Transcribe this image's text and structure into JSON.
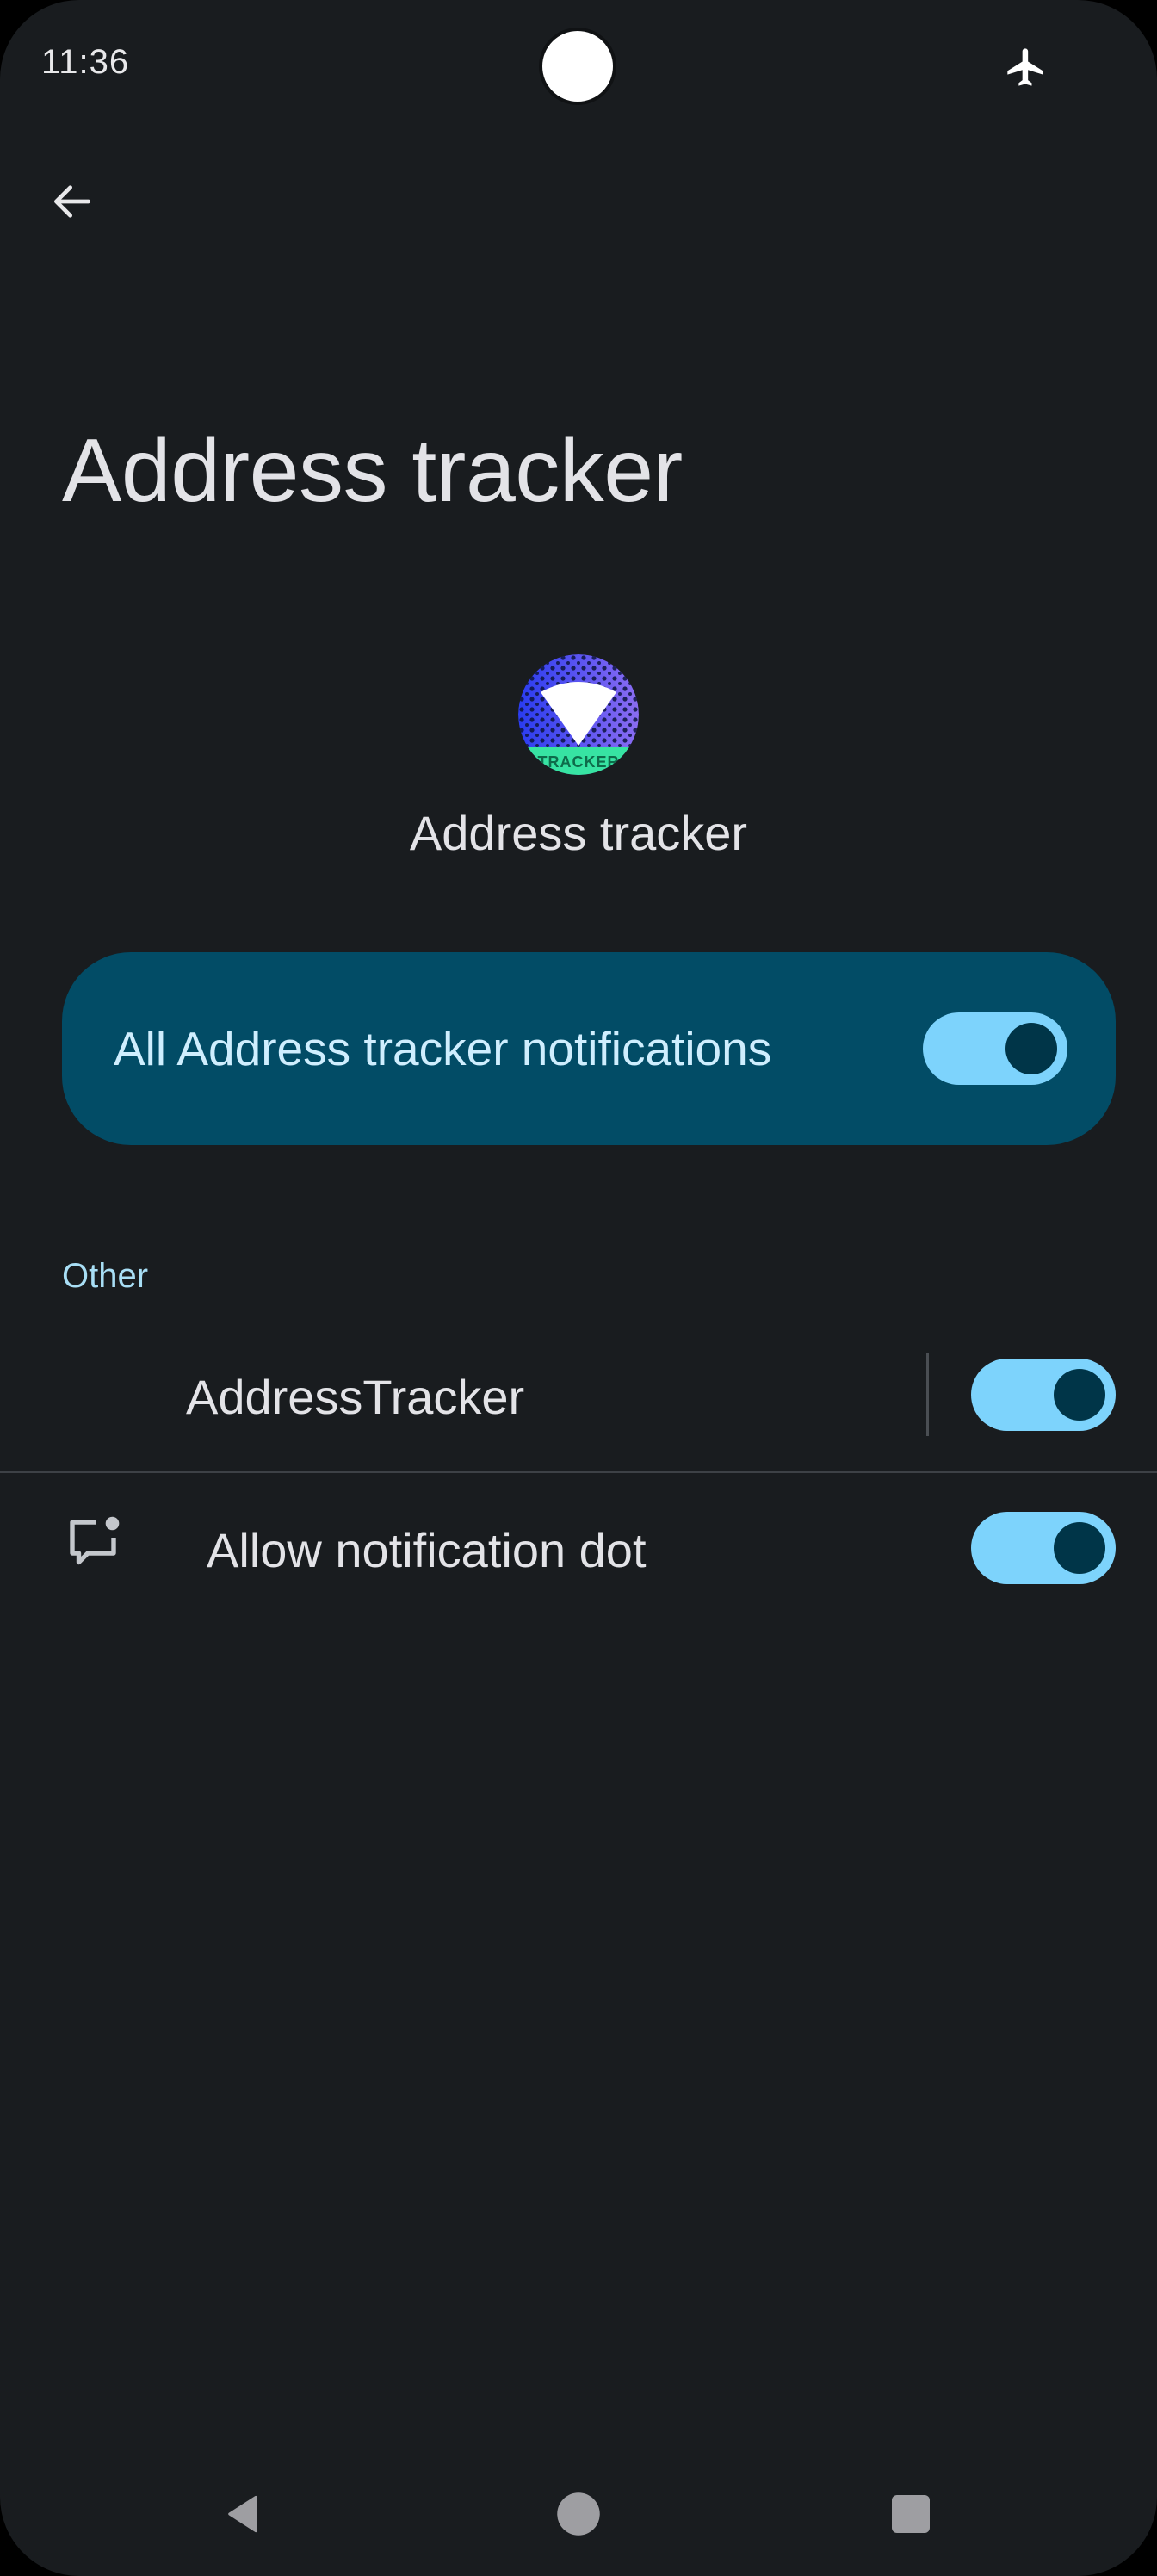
{
  "status_bar": {
    "time": "11:36",
    "icons": [
      "airplane-mode-icon"
    ]
  },
  "top_bar": {
    "back_icon": "arrow-back-icon"
  },
  "page": {
    "title": "Address tracker"
  },
  "app_header": {
    "icon": "address-tracker-app-icon",
    "icon_text": "TRACKER",
    "name": "Address tracker"
  },
  "master_toggle": {
    "label": "All Address tracker notifications",
    "checked": true
  },
  "category": {
    "header": "Other",
    "channels": [
      {
        "label": "AddressTracker",
        "checked": true
      }
    ]
  },
  "notification_dot": {
    "icon": "notification-dot-icon",
    "label": "Allow notification dot",
    "checked": true
  },
  "nav_bar": {
    "buttons": [
      "nav-back-icon",
      "nav-home-icon",
      "nav-recents-icon"
    ]
  },
  "colors": {
    "background": "#191c1f",
    "card": "#024c66",
    "switch_track": "#7dd3fc",
    "switch_thumb": "#003548",
    "accent_text": "#a8def5"
  }
}
